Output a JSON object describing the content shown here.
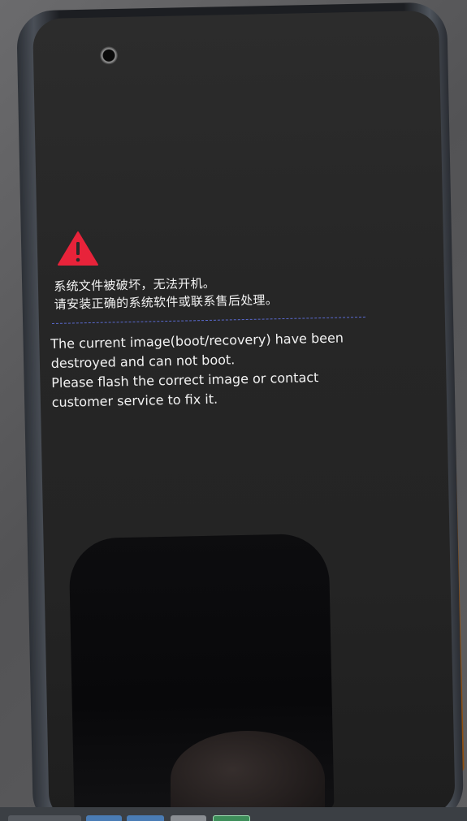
{
  "screen": {
    "message_cn": [
      "系统文件被破坏，无法开机。",
      "请安装正确的系统软件或联系售后处理。"
    ],
    "message_en": [
      "The current image(boot/recovery) have been",
      "destroyed and can not boot.",
      "Please flash the correct image or contact",
      "customer service to fix it."
    ]
  },
  "colors": {
    "warning_red": "#e8233a",
    "divider_blue": "#5a6ad0",
    "screen_bg": "#262626",
    "case_orange": "#d98a2a"
  },
  "icons": {
    "warning": "warning-triangle-icon"
  }
}
